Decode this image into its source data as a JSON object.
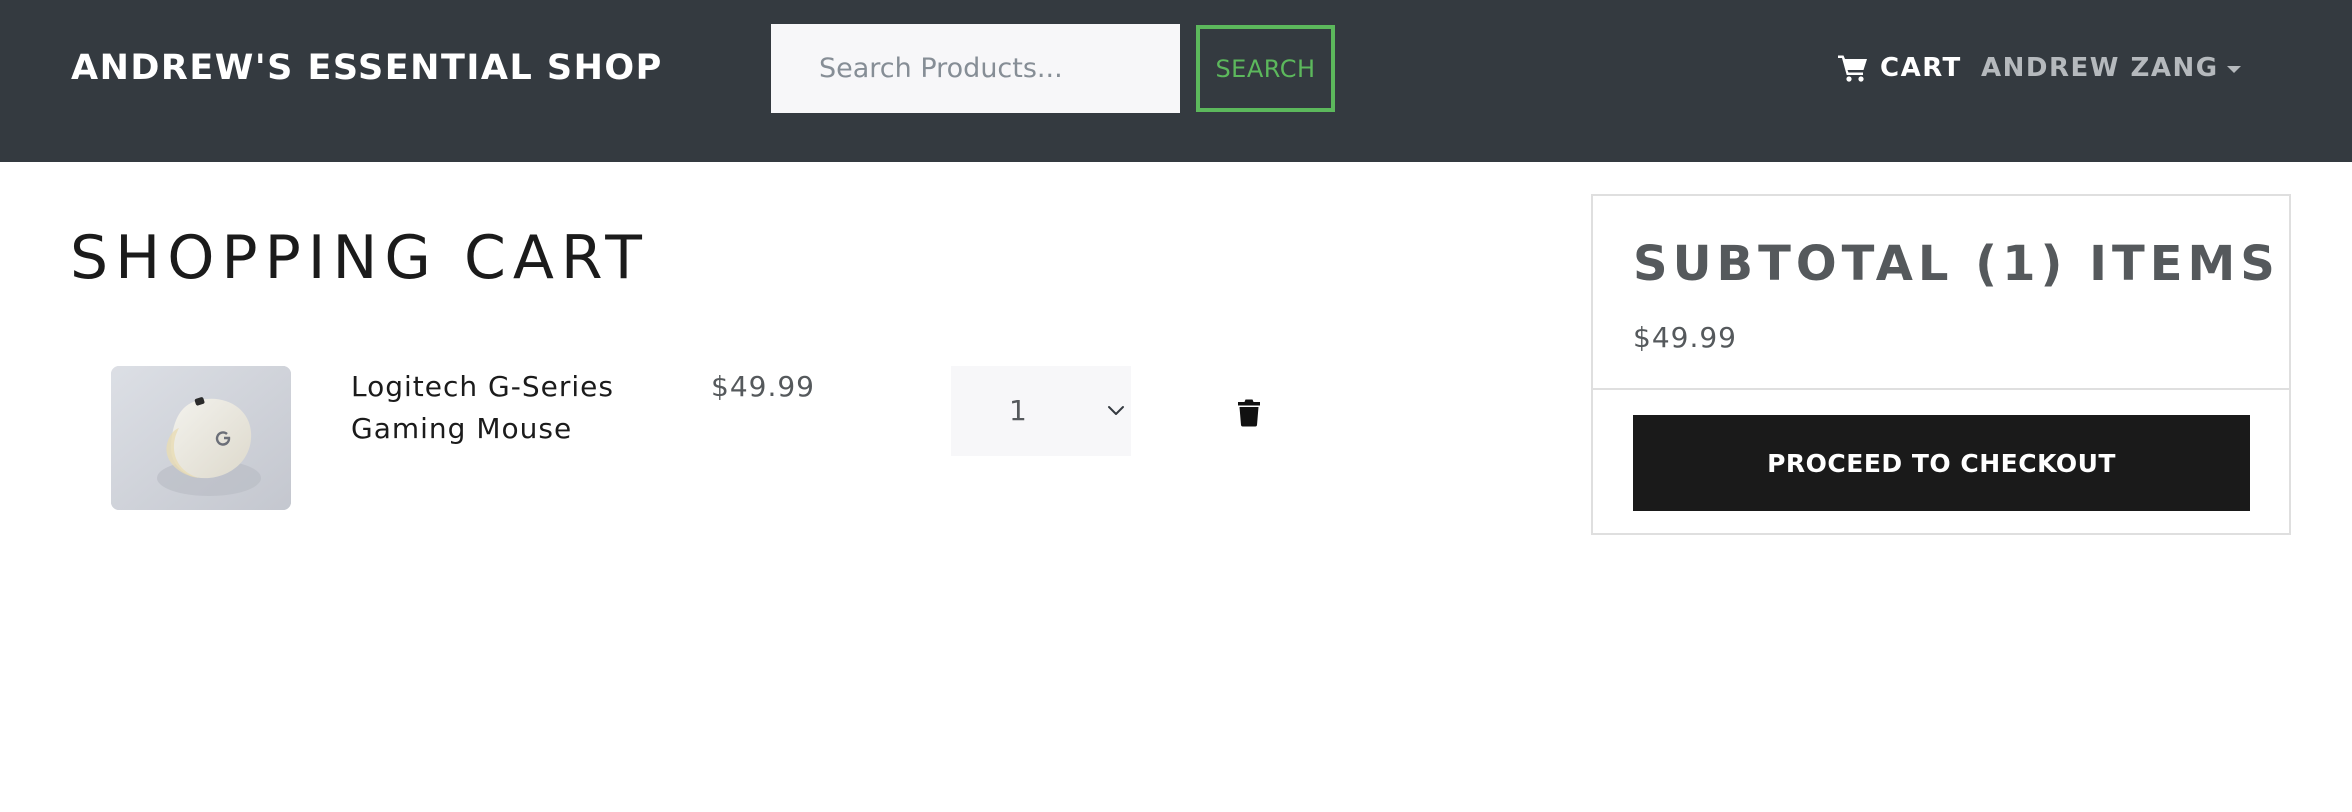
{
  "navbar": {
    "brand": "ANDREW'S ESSENTIAL SHOP",
    "search_placeholder": "Search Products...",
    "search_label": "SEARCH",
    "cart_label": "CART",
    "user_label": "ANDREW ZANG",
    "bg_color": "#343a40",
    "accent_color": "#5cb85c"
  },
  "cart": {
    "title": "SHOPPING CART",
    "items": [
      {
        "name": "Logitech G-Series Gaming Mouse",
        "price": "$49.99",
        "quantity": "1",
        "image_icon": "gaming-mouse-photo",
        "delete_icon": "trash-icon"
      }
    ]
  },
  "summary": {
    "title": "SUBTOTAL (1) ITEMS",
    "amount": "$49.99",
    "checkout_label": "PROCEED TO CHECKOUT",
    "button_color": "#1a1a1a"
  }
}
